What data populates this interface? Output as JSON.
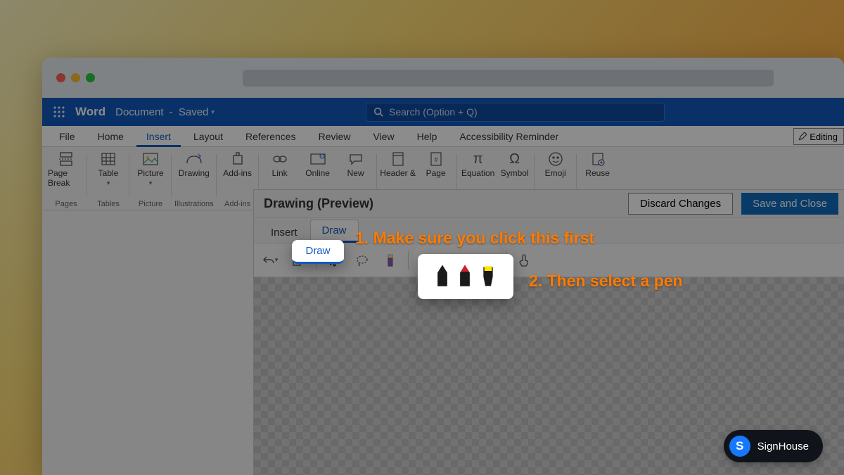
{
  "browser": {},
  "word": {
    "app_name": "Word",
    "doc_name": "Document",
    "save_status": "Saved",
    "search_placeholder": "Search (Option + Q)"
  },
  "ribbon_tabs": [
    "File",
    "Home",
    "Insert",
    "Layout",
    "References",
    "Review",
    "View",
    "Help",
    "Accessibility Reminder"
  ],
  "ribbon_active_tab": "Insert",
  "editing_mode": "Editing",
  "ribbon_groups": [
    {
      "label": "Pages",
      "items": [
        {
          "label": "Page Break"
        }
      ]
    },
    {
      "label": "Tables",
      "items": [
        {
          "label": "Table",
          "dropdown": true
        }
      ]
    },
    {
      "label": "Picture",
      "items": [
        {
          "label": "Picture",
          "dropdown": true
        }
      ]
    },
    {
      "label": "Illustrations",
      "items": [
        {
          "label": "Drawing"
        }
      ]
    },
    {
      "label": "Add-ins",
      "items": [
        {
          "label": "Add-ins"
        }
      ]
    },
    {
      "label": "",
      "items": [
        {
          "label": "Link"
        },
        {
          "label": "Online"
        },
        {
          "label": "New"
        }
      ]
    },
    {
      "label": "",
      "items": [
        {
          "label": "Header &"
        },
        {
          "label": "Page"
        }
      ]
    },
    {
      "label": "",
      "items": [
        {
          "label": "Equation"
        },
        {
          "label": "Symbol"
        }
      ]
    },
    {
      "label": "",
      "items": [
        {
          "label": "Emoji"
        }
      ]
    },
    {
      "label": "",
      "items": [
        {
          "label": "Reuse"
        }
      ]
    }
  ],
  "drawing_panel": {
    "title": "Drawing (Preview)",
    "discard_label": "Discard Changes",
    "save_label": "Save and Close",
    "tabs": [
      "Insert",
      "Draw"
    ],
    "active_tab": "Draw",
    "pens": [
      {
        "name": "black-pen",
        "color": "#1a1a1a"
      },
      {
        "name": "red-pen",
        "color": "#d81b2c"
      },
      {
        "name": "yellow-highlighter",
        "color": "#ffe600"
      }
    ]
  },
  "annotations": {
    "step1": "1. Make sure you click this first",
    "step2": "2. Then select a pen"
  },
  "badge": {
    "logo_letter": "S",
    "label": "SignHouse"
  }
}
